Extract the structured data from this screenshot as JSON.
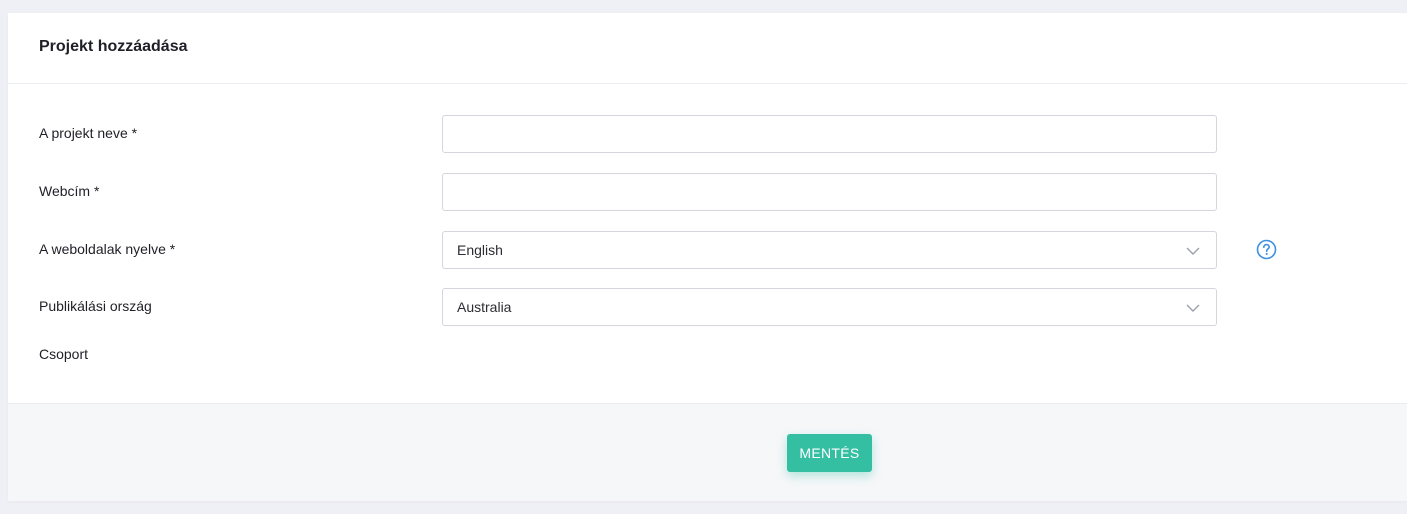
{
  "header": {
    "title": "Projekt hozzáadása"
  },
  "form": {
    "project_name": {
      "label": "A projekt neve *",
      "value": "",
      "placeholder": ""
    },
    "web_address": {
      "label": "Webcím *",
      "value": "",
      "placeholder": ""
    },
    "language": {
      "label": "A weboldalak nyelve *",
      "selected": "English"
    },
    "country": {
      "label": "Publikálási ország",
      "selected": "Australia"
    },
    "group": {
      "label": "Csoport"
    }
  },
  "footer": {
    "save_label": "MENTÉS"
  },
  "icons": {
    "help": "question-circle-icon",
    "dropdown": "chevron-down-icon"
  },
  "colors": {
    "accent": "#34bfa3",
    "help": "#3d8fe0",
    "border": "#d3d6de"
  }
}
